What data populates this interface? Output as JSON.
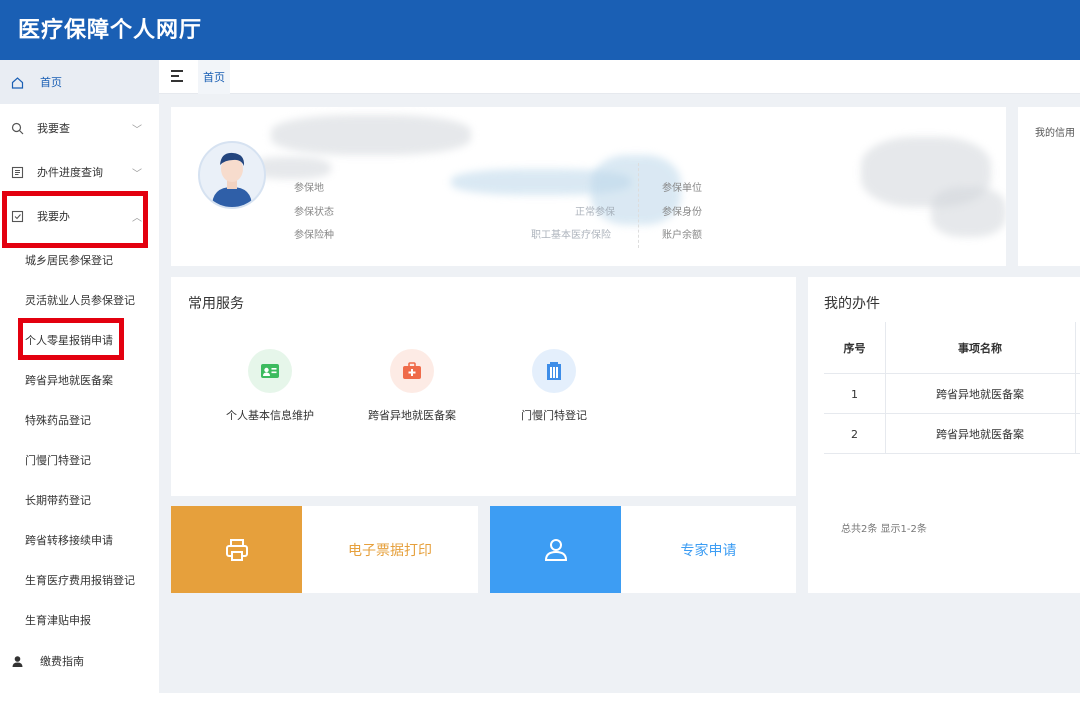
{
  "header": {
    "title": "医疗保障个人网厅"
  },
  "sidebar": {
    "home": "首页",
    "query": "我要查",
    "progress": "办件进度查询",
    "todo": "我要办",
    "sub_items": [
      "城乡居民参保登记",
      "灵活就业人员参保登记",
      "个人零星报销申请",
      "跨省异地就医备案",
      "特殊药品登记",
      "门慢门特登记",
      "长期带药登记",
      "跨省转移接续申请",
      "生育医疗费用报销登记",
      "生育津贴申报"
    ],
    "guide": "缴费指南"
  },
  "breadcrumb": {
    "current": "首页"
  },
  "profile": {
    "labels": {
      "area": "参保地",
      "status": "参保状态",
      "insurance_type": "参保险种",
      "unit": "参保单位",
      "identity": "参保身份",
      "balance": "账户余额"
    },
    "values": {
      "status": "正常参保",
      "insurance_type": "职工基本医疗保险"
    }
  },
  "credit": {
    "title": "我的信用"
  },
  "services": {
    "title": "常用服务",
    "items": [
      {
        "label": "个人基本信息维护",
        "icon": "id-card-icon",
        "color": "#3dbb5f",
        "bg": "#e6f6ea"
      },
      {
        "label": "跨省异地就医备案",
        "icon": "medical-kit-icon",
        "color": "#ef6b4a",
        "bg": "#fdebe5"
      },
      {
        "label": "门慢门特登记",
        "icon": "hospital-building-icon",
        "color": "#3d8de8",
        "bg": "#e4effc"
      }
    ]
  },
  "tiles": {
    "print": {
      "label": "电子票据打印",
      "color": "#e6a03c",
      "icon": "printer-icon"
    },
    "expert": {
      "label": "专家申请",
      "color": "#3d9df3",
      "icon": "user-icon"
    }
  },
  "tasks": {
    "title": "我的办件",
    "columns": [
      "序号",
      "事项名称"
    ],
    "rows": [
      {
        "no": "1",
        "name": "跨省异地就医备案"
      },
      {
        "no": "2",
        "name": "跨省异地就医备案"
      }
    ],
    "pager": "总共2条 显示1-2条"
  }
}
